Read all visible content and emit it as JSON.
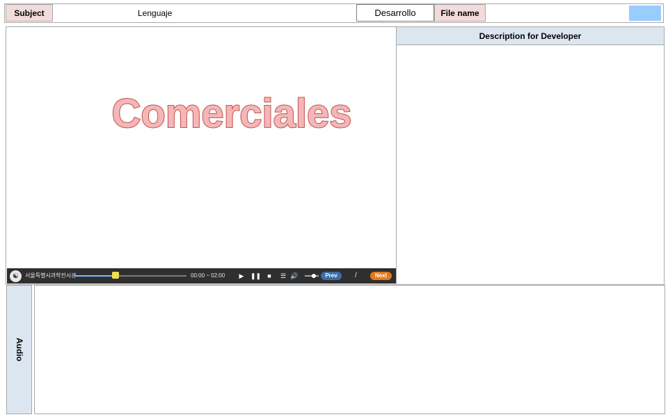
{
  "header": {
    "subject_label": "Subject",
    "subject_value": "Lenguaje",
    "unit_value": "Desarrollo",
    "file_label": "File name",
    "file_value": "",
    "swatch_color": "#99ccff"
  },
  "stage": {
    "title": "Comerciales",
    "title_fill": "#f4b6b6",
    "title_stroke": "#c0504d"
  },
  "player": {
    "org_name": "서울특별시과학전시관",
    "time": "00:00 ~ 02:00",
    "progress_fraction": 0.37,
    "play_icon": "play-icon",
    "pause_icon": "pause-icon",
    "stop_icon": "stop-icon",
    "menu_icon": "menu-icon",
    "volume_icon": "volume-icon",
    "prev_label": "Prev",
    "separator": "/",
    "next_label": "Next"
  },
  "description": {
    "heading": "Description for Developer",
    "body": ""
  },
  "audio": {
    "label": "Audio",
    "body": ""
  }
}
